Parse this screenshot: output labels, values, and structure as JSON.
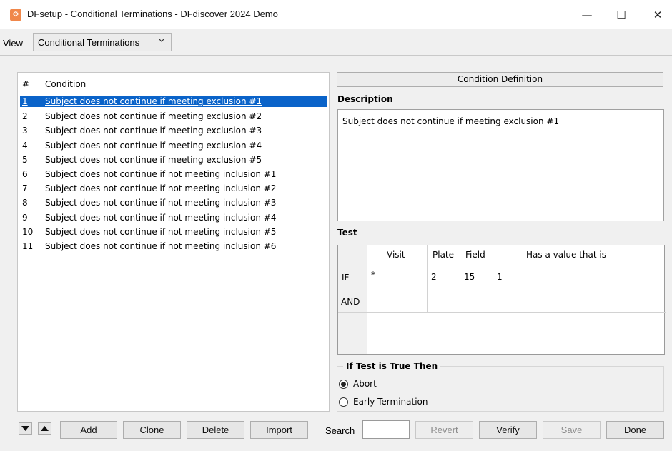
{
  "window": {
    "title": "DFsetup - Conditional Terminations - DFdiscover 2024 Demo",
    "minimize": "—",
    "maximize": "☐",
    "close": "✕"
  },
  "view": {
    "label": "View",
    "selected": "Conditional Terminations"
  },
  "list": {
    "headers": {
      "num": "#",
      "condition": "Condition"
    },
    "rows": [
      {
        "num": "1",
        "text": "Subject does not continue if meeting exclusion #1"
      },
      {
        "num": "2",
        "text": "Subject does not continue if meeting exclusion #2"
      },
      {
        "num": "3",
        "text": "Subject does not continue if meeting exclusion #3"
      },
      {
        "num": "4",
        "text": "Subject does not continue if meeting exclusion #4"
      },
      {
        "num": "5",
        "text": "Subject does not continue if meeting exclusion #5"
      },
      {
        "num": "6",
        "text": "Subject does not continue if not meeting inclusion #1"
      },
      {
        "num": "7",
        "text": "Subject does not continue if not meeting inclusion #2"
      },
      {
        "num": "8",
        "text": "Subject does not continue if not meeting inclusion #3"
      },
      {
        "num": "9",
        "text": "Subject does not continue if not meeting inclusion #4"
      },
      {
        "num": "10",
        "text": "Subject does not continue if not meeting inclusion #5"
      },
      {
        "num": "11",
        "text": "Subject does not continue if not meeting inclusion #6"
      }
    ]
  },
  "definition": {
    "header": "Condition Definition",
    "description_label": "Description",
    "description_text": "Subject does not continue if meeting exclusion #1",
    "test_label": "Test",
    "test": {
      "columns": [
        "Visit",
        "Plate",
        "Field",
        "Has a value that is"
      ],
      "row1": {
        "op": "IF",
        "visit": "*",
        "plate": "2",
        "field": "15",
        "value": "1"
      },
      "row2": {
        "op": "AND"
      }
    },
    "then_label": "If Test is True Then",
    "options": {
      "abort": "Abort",
      "early": "Early Termination"
    }
  },
  "buttons": {
    "add": "Add",
    "clone": "Clone",
    "delete": "Delete",
    "import": "Import",
    "search_label": "Search",
    "revert": "Revert",
    "verify": "Verify",
    "save": "Save",
    "done": "Done"
  },
  "colors": {
    "selection": "#0a63c9",
    "app_icon": "#f0874a"
  }
}
